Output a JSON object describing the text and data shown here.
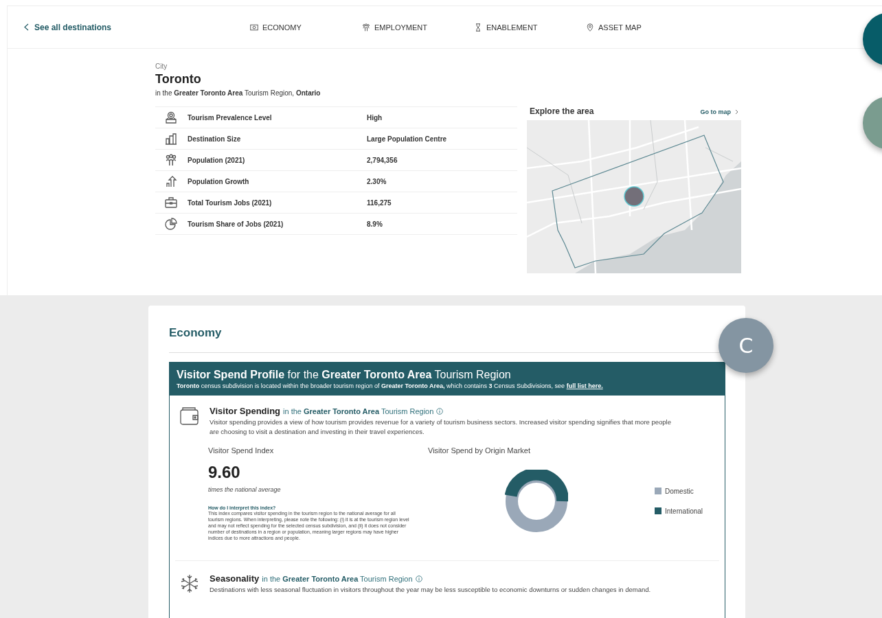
{
  "nav": {
    "back": "See all destinations",
    "tabs": [
      {
        "label": "ECONOMY"
      },
      {
        "label": "EMPLOYMENT"
      },
      {
        "label": "ENABLEMENT"
      },
      {
        "label": "ASSET MAP"
      }
    ]
  },
  "place": {
    "type": "City",
    "name": "Toronto",
    "region": "in the **Greater Toronto Area**  Tourism Region, **Ontario**"
  },
  "facts": [
    {
      "label": "Tourism Prevalence Level",
      "value": "High"
    },
    {
      "label": "Destination Size",
      "value": "Large Population Centre"
    },
    {
      "label": "Population (2021)",
      "value": "2,794,356"
    },
    {
      "label": "Population Growth",
      "value": "2.30%"
    },
    {
      "label": "Total Tourism Jobs (2021)",
      "value": "116,275"
    },
    {
      "label": "Tourism Share of Jobs (2021)",
      "value": "8.9%"
    }
  ],
  "map_panel": {
    "title": "Explore the area",
    "link": "Go to map"
  },
  "economy": {
    "title": "Economy",
    "badge": "C",
    "profile": {
      "title": "**Visitor Spend Profile** for the **Greater Toronto Area** Tourism Region",
      "subtitle": "**Toronto** census subdivision is located within the broader tourism region of **Greater Toronto Area,** which contains **3** Census Subdivisions, see",
      "subtitle_link": "full list here.",
      "sections": [
        {
          "title": "Visitor Spending",
          "context": "in the **Greater Toronto Area** Tourism Region",
          "description": "Visitor spending provides a view of how tourism provides revenue for a variety of tourism business sectors. Increased visitor spending signifies that more people are choosing to visit a destination and investing in their travel experiences.",
          "index": {
            "title": "Visitor Spend Index",
            "value": "9.60",
            "caption": "times the national average",
            "help_title": "How do I interpret this index?",
            "help_text": "This index compares visitor spending in the tourism region to the national average for all tourism regions. When interpreting, please note the following: (i) it is at the tourism region level and may not reflect spending for the selected census subdivision, and (ii) it does not consider number of destinations in a region or population, meaning larger regions may have higher indices due to more attractions and people."
          },
          "origin": {
            "title": "Visitor Spend by Origin Market",
            "legend": [
              {
                "label": "Domestic",
                "color": "#9aa8b8"
              },
              {
                "label": "International",
                "color": "#245c66"
              }
            ]
          }
        },
        {
          "title": "Seasonality",
          "context": "in the **Greater Toronto Area** Tourism Region",
          "description": "Destinations with less seasonal fluctuation in visitors throughout the year may be less susceptible to economic downturns or sudden changes in demand."
        }
      ]
    }
  },
  "floating_buttons": [
    {
      "color": "#075c68"
    },
    {
      "color": "#7a9c8f"
    }
  ]
}
